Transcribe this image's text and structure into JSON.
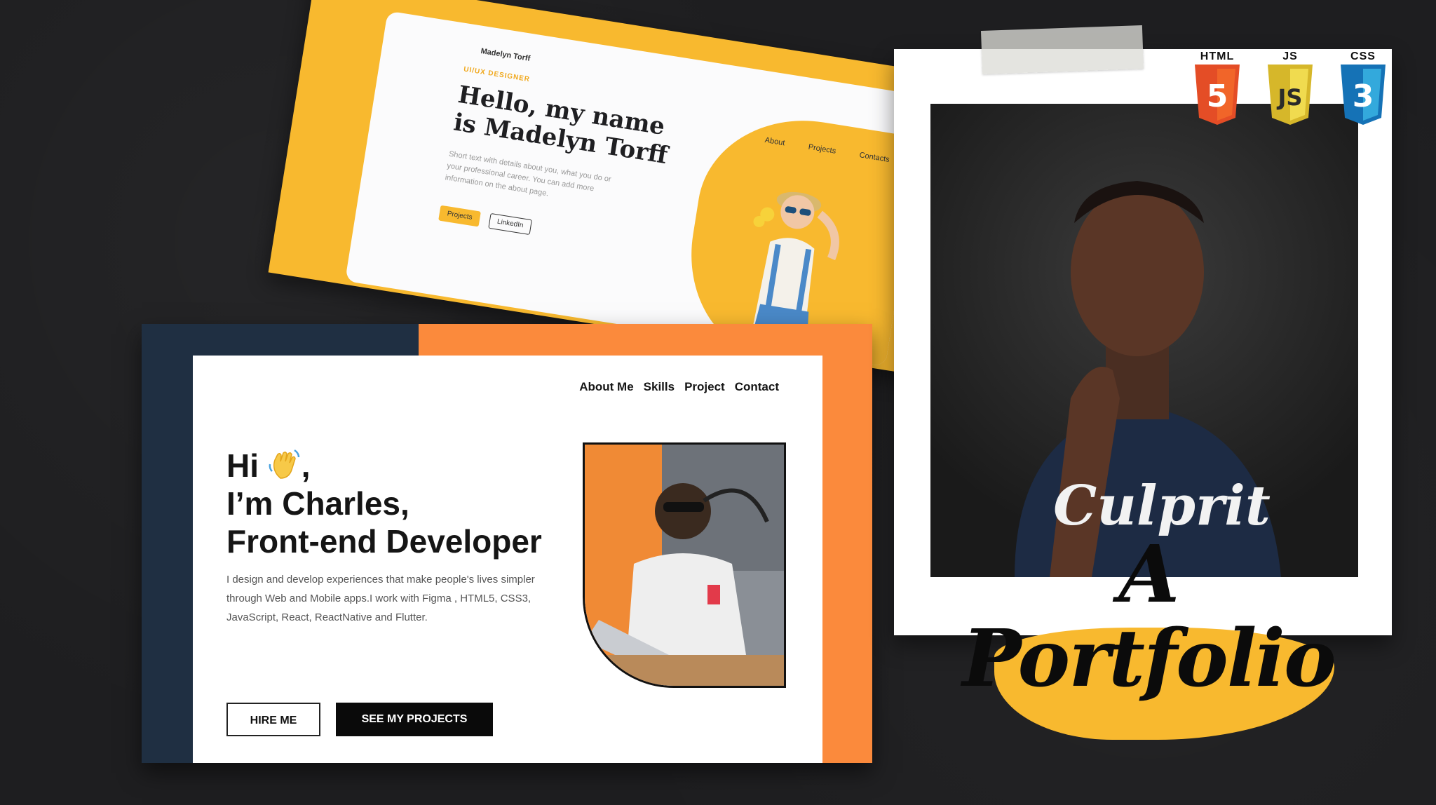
{
  "yellow_site": {
    "brand": "Madelyn Torff",
    "eyebrow": "UI/UX DESIGNER",
    "title": "Hello,  my name is Madelyn Torff",
    "description": "Short text with details about you, what you do or your professional career. You can add more information on the about page.",
    "primary_button": "Projects",
    "secondary_button": "LinkedIn",
    "nav": [
      "About",
      "Projects",
      "Contacts"
    ]
  },
  "charles_site": {
    "nav": [
      "About Me",
      "Skills",
      "Project",
      "Contact"
    ],
    "heading_line1": "Hi",
    "heading_line1_suffix": ",",
    "heading_line2": "I’m Charles,",
    "heading_line3": "Front-end Developer",
    "description": "I design and develop experiences that make people's lives simpler through Web and Mobile apps.I work with Figma , HTML5, CSS3, JavaScript, React, ReactNative and Flutter.",
    "hire_button": "HIRE ME",
    "projects_button": "SEE MY PROJECTS"
  },
  "polaroid": {
    "tech": [
      {
        "label": "HTML",
        "digit": "5",
        "color": "#e44d26",
        "icon": "html5-icon"
      },
      {
        "label": "JS",
        "digit": "JS",
        "color": "#f0db4f",
        "icon": "js-icon"
      },
      {
        "label": "CSS",
        "digit": "3",
        "color": "#1572b6",
        "icon": "css3-icon"
      }
    ],
    "shirt_text": "Culprit",
    "title": "A Portfolio"
  },
  "colors": {
    "yellow": "#f8b92f",
    "orange": "#fb8a3c",
    "navy": "#1f2f42",
    "background": "#1e1e20"
  }
}
